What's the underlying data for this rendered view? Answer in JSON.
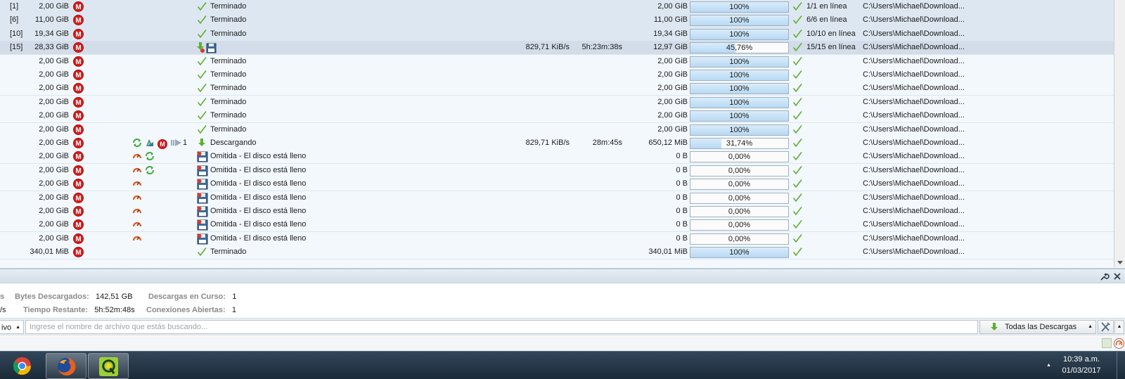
{
  "table": {
    "rows": [
      {
        "kind": "pkg",
        "count": "[1]",
        "size": "2,00 GiB",
        "plugins": [],
        "status_icon": "check",
        "status": "Terminado",
        "speed": "",
        "eta": "",
        "loaded": "2,00 GiB",
        "progress": 100,
        "progress_label": "100%",
        "availability": "1/1 en línea",
        "path": "C:\\Users\\Michael\\Download..."
      },
      {
        "kind": "pkg",
        "count": "[6]",
        "size": "11,00 GiB",
        "plugins": [],
        "status_icon": "check",
        "status": "Terminado",
        "speed": "",
        "eta": "",
        "loaded": "11,00 GiB",
        "progress": 100,
        "progress_label": "100%",
        "availability": "6/6 en línea",
        "path": "C:\\Users\\Michael\\Download..."
      },
      {
        "kind": "pkg",
        "count": "[10]",
        "size": "19,34 GiB",
        "plugins": [],
        "status_icon": "check",
        "status": "Terminado",
        "speed": "",
        "eta": "",
        "loaded": "19,34 GiB",
        "progress": 100,
        "progress_label": "100%",
        "availability": "10/10 en línea",
        "path": "C:\\Users\\Michael\\Download..."
      },
      {
        "kind": "pkg",
        "sel": true,
        "count": "[15]",
        "size": "28,33 GiB",
        "plugins": [],
        "status_icon": "download-disk",
        "status": "",
        "speed": "829,71 KiB/s",
        "eta": "5h:23m:38s",
        "loaded": "12,97 GiB",
        "progress": 45.76,
        "progress_label": "45,76%",
        "availability": "15/15 en línea",
        "path": "C:\\Users\\Michael\\Download..."
      },
      {
        "kind": "file",
        "count": "",
        "size": "2,00 GiB",
        "plugins": [],
        "status_icon": "check",
        "status": "Terminado",
        "speed": "",
        "eta": "",
        "loaded": "2,00 GiB",
        "progress": 100,
        "progress_label": "100%",
        "availability": "",
        "path": "C:\\Users\\Michael\\Download..."
      },
      {
        "kind": "file",
        "count": "",
        "size": "2,00 GiB",
        "plugins": [],
        "status_icon": "check",
        "status": "Terminado",
        "speed": "",
        "eta": "",
        "loaded": "2,00 GiB",
        "progress": 100,
        "progress_label": "100%",
        "availability": "",
        "path": "C:\\Users\\Michael\\Download..."
      },
      {
        "kind": "file",
        "count": "",
        "size": "2,00 GiB",
        "plugins": [],
        "status_icon": "check",
        "status": "Terminado",
        "speed": "",
        "eta": "",
        "loaded": "2,00 GiB",
        "progress": 100,
        "progress_label": "100%",
        "availability": "",
        "path": "C:\\Users\\Michael\\Download..."
      },
      {
        "kind": "file",
        "count": "",
        "size": "2,00 GiB",
        "plugins": [],
        "status_icon": "check",
        "status": "Terminado",
        "speed": "",
        "eta": "",
        "loaded": "2,00 GiB",
        "progress": 100,
        "progress_label": "100%",
        "availability": "",
        "path": "C:\\Users\\Michael\\Download..."
      },
      {
        "kind": "file",
        "count": "",
        "size": "2,00 GiB",
        "plugins": [],
        "status_icon": "check",
        "status": "Terminado",
        "speed": "",
        "eta": "",
        "loaded": "2,00 GiB",
        "progress": 100,
        "progress_label": "100%",
        "availability": "",
        "path": "C:\\Users\\Michael\\Download..."
      },
      {
        "kind": "file",
        "count": "",
        "size": "2,00 GiB",
        "plugins": [],
        "status_icon": "check",
        "status": "Terminado",
        "speed": "",
        "eta": "",
        "loaded": "2,00 GiB",
        "progress": 100,
        "progress_label": "100%",
        "availability": "",
        "path": "C:\\Users\\Michael\\Download..."
      },
      {
        "kind": "file",
        "count": "",
        "size": "2,00 GiB",
        "plugins": [
          "refresh",
          "resume",
          "mega",
          "chunks"
        ],
        "chunks": "1",
        "status_icon": "download",
        "status": "Descargando",
        "speed": "829,71 KiB/s",
        "eta": "28m:45s",
        "loaded": "650,12 MiB",
        "progress": 31.74,
        "progress_label": "31,74%",
        "availability": "",
        "path": "C:\\Users\\Michael\\Download..."
      },
      {
        "kind": "file",
        "count": "",
        "size": "2,00 GiB",
        "plugins": [
          "speedmeter",
          "refresh"
        ],
        "status_icon": "disk-full",
        "status": "Omitida - El disco está lleno",
        "speed": "",
        "eta": "",
        "loaded": "0 B",
        "progress": 0,
        "progress_label": "0,00%",
        "availability": "",
        "path": "C:\\Users\\Michael\\Download..."
      },
      {
        "kind": "file",
        "count": "",
        "size": "2,00 GiB",
        "plugins": [
          "speedmeter",
          "refresh"
        ],
        "status_icon": "disk-full",
        "status": "Omitida - El disco está lleno",
        "speed": "",
        "eta": "",
        "loaded": "0 B",
        "progress": 0,
        "progress_label": "0,00%",
        "availability": "",
        "path": "C:\\Users\\Michael\\Download..."
      },
      {
        "kind": "file",
        "count": "",
        "size": "2,00 GiB",
        "plugins": [
          "speedmeter"
        ],
        "status_icon": "disk-full",
        "status": "Omitida - El disco está lleno",
        "speed": "",
        "eta": "",
        "loaded": "0 B",
        "progress": 0,
        "progress_label": "0,00%",
        "availability": "",
        "path": "C:\\Users\\Michael\\Download..."
      },
      {
        "kind": "file",
        "count": "",
        "size": "2,00 GiB",
        "plugins": [
          "speedmeter"
        ],
        "status_icon": "disk-full",
        "status": "Omitida - El disco está lleno",
        "speed": "",
        "eta": "",
        "loaded": "0 B",
        "progress": 0,
        "progress_label": "0,00%",
        "availability": "",
        "path": "C:\\Users\\Michael\\Download..."
      },
      {
        "kind": "file",
        "count": "",
        "size": "2,00 GiB",
        "plugins": [
          "speedmeter"
        ],
        "status_icon": "disk-full",
        "status": "Omitida - El disco está lleno",
        "speed": "",
        "eta": "",
        "loaded": "0 B",
        "progress": 0,
        "progress_label": "0,00%",
        "availability": "",
        "path": "C:\\Users\\Michael\\Download..."
      },
      {
        "kind": "file",
        "count": "",
        "size": "2,00 GiB",
        "plugins": [
          "speedmeter"
        ],
        "status_icon": "disk-full",
        "status": "Omitida - El disco está lleno",
        "speed": "",
        "eta": "",
        "loaded": "0 B",
        "progress": 0,
        "progress_label": "0,00%",
        "availability": "",
        "path": "C:\\Users\\Michael\\Download..."
      },
      {
        "kind": "file",
        "count": "",
        "size": "2,00 GiB",
        "plugins": [
          "speedmeter"
        ],
        "status_icon": "disk-full",
        "status": "Omitida - El disco está lleno",
        "speed": "",
        "eta": "",
        "loaded": "0 B",
        "progress": 0,
        "progress_label": "0,00%",
        "availability": "",
        "path": "C:\\Users\\Michael\\Download..."
      },
      {
        "kind": "file",
        "count": "",
        "size": "340,01 MiB",
        "plugins": [],
        "status_icon": "check",
        "status": "Terminado",
        "speed": "",
        "eta": "",
        "loaded": "340,01 MiB",
        "progress": 100,
        "progress_label": "100%",
        "availability": "",
        "path": "C:\\Users\\Michael\\Download..."
      }
    ]
  },
  "info": {
    "left_cut_1": "s",
    "left_cut_2": "/s",
    "bytes_label": "Bytes Descargados:",
    "bytes_value": "142,51 GB",
    "remaining_label": "Tiempo Restante:",
    "remaining_value": "5h:52m:48s",
    "running_label": "Descargas en Curso:",
    "running_value": "1",
    "connections_label": "Conexiones Abiertas:",
    "connections_value": "1"
  },
  "search": {
    "scope": "ivo",
    "placeholder": "Ingrese el nombre de archivo que estás buscando...",
    "filter_label": "Todas las Descargas"
  },
  "taskbar": {
    "apps": [
      "chrome",
      "firefox",
      "jdownloader"
    ],
    "time": "10:39 a.m.",
    "date": "01/03/2017"
  },
  "colors": {
    "accent": "#5fae2e",
    "mega": "#d71c1c",
    "progress": "#b8d9f3"
  }
}
